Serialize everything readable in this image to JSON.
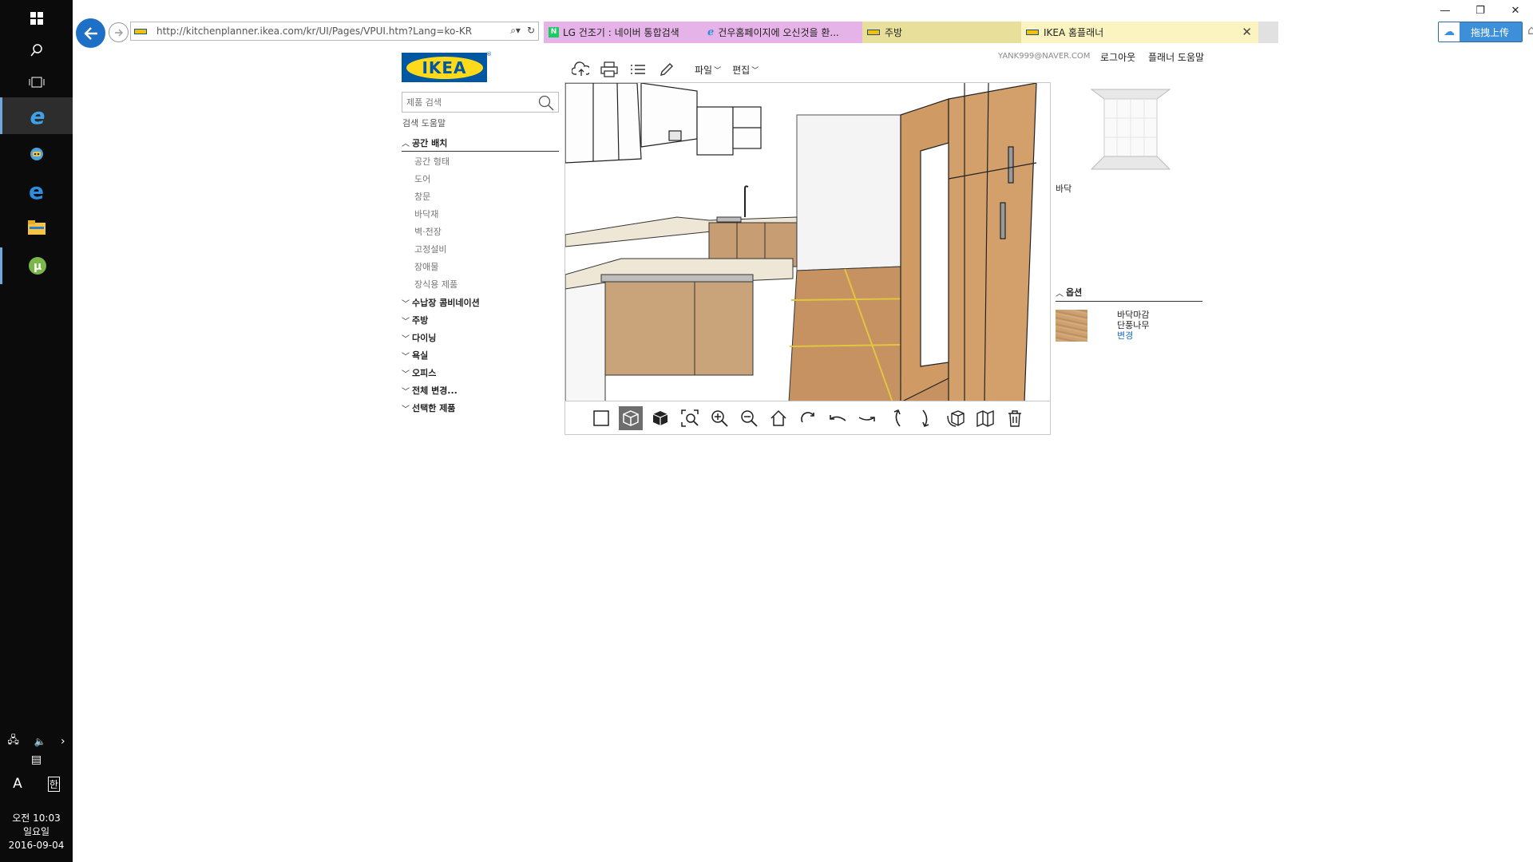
{
  "taskbar": {
    "clock_time": "오전 10:03",
    "clock_day": "일요일",
    "clock_date": "2016-09-04",
    "ime_letter": "A",
    "ime_hangul": "한"
  },
  "browser": {
    "url": "http://kitchenplanner.ikea.com/kr/UI/Pages/VPUI.htm?Lang=ko-KR",
    "tabs": [
      {
        "title": "LG 건조기 : 네이버 통합검색",
        "color": "#e6b3e8"
      },
      {
        "title": "건우홈페이지에 오신것을 환...",
        "color": "#e6b3e8"
      },
      {
        "title": "주방",
        "color": "#e8e09a"
      },
      {
        "title": "IKEA 홈플래너",
        "color": "#fbf3c0"
      }
    ],
    "upload_label": "拖拽上传"
  },
  "header": {
    "logo_text": "IKEA",
    "account": "YANK999@NAVER.COM",
    "logout": "로그아웃",
    "planner_help": "플래너 도움말",
    "menu_file": "파일",
    "menu_edit": "편집"
  },
  "sidebar": {
    "search_placeholder": "제품 검색",
    "search_help": "검색 도움말",
    "open_category": "공간 배치",
    "sub_items": [
      "공간 형태",
      "도어",
      "창문",
      "바닥재",
      "벽·천장",
      "고정설비",
      "장애물",
      "장식용 제품"
    ],
    "categories": [
      "수납장 콤비네이션",
      "주방",
      "다이닝",
      "욕실",
      "오피스",
      "전체 변경...",
      "선택한 제품"
    ]
  },
  "right_panel": {
    "room_label": "바닥",
    "options_title": "옵션",
    "option_name": "바닥마감",
    "option_value": "단풍나무",
    "option_change": "변경"
  },
  "colors": {
    "ikea_blue": "#0058a3",
    "ikea_yellow": "#ffda1a",
    "floor": "#c69262",
    "link": "#1b6fc9"
  }
}
